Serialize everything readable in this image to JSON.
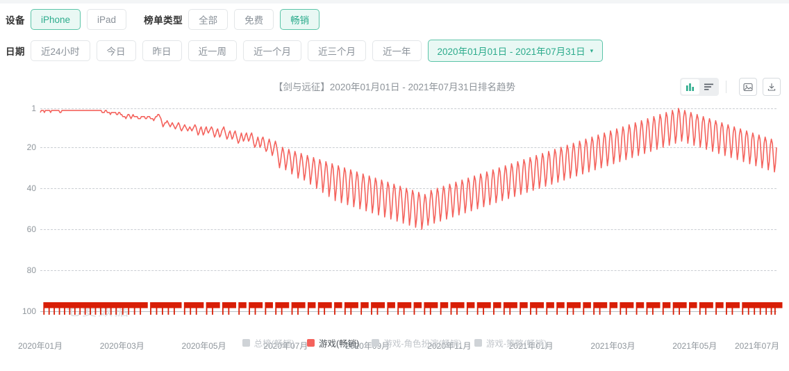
{
  "filters": {
    "device": {
      "label": "设备",
      "options": [
        {
          "label": "iPhone",
          "active": true
        },
        {
          "label": "iPad",
          "active": false
        }
      ]
    },
    "list_type": {
      "label": "榜单类型",
      "options": [
        {
          "label": "全部",
          "active": false
        },
        {
          "label": "免费",
          "active": false
        },
        {
          "label": "畅销",
          "active": true
        }
      ]
    },
    "date": {
      "label": "日期",
      "options": [
        {
          "label": "近24小时",
          "active": false
        },
        {
          "label": "今日",
          "active": false
        },
        {
          "label": "昨日",
          "active": false
        },
        {
          "label": "近一周",
          "active": false
        },
        {
          "label": "近一个月",
          "active": false
        },
        {
          "label": "近三个月",
          "active": false
        },
        {
          "label": "近一年",
          "active": false
        }
      ],
      "range_picker": {
        "label": "2020年01月01日 - 2021年07月31日",
        "caret": "▾",
        "active": true
      }
    }
  },
  "chart_card": {
    "title": "【剑与远征】2020年01月01日 - 2021年07月31日排名趋势",
    "toolbar": {
      "view_chart": "bar-chart-icon",
      "view_list": "list-icon",
      "save_image": "image-icon",
      "download": "download-icon"
    },
    "watermark": "七麦数据"
  },
  "chart_data": {
    "type": "line",
    "title": "【剑与远征】2020年01月01日 - 2021年07月31日排名趋势",
    "xlabel": "",
    "ylabel": "",
    "y_inverted": true,
    "ylim": [
      1,
      100
    ],
    "yticks": [
      1,
      20,
      40,
      60,
      80,
      100
    ],
    "grid": true,
    "grid_style": "dashed",
    "legend_position": "bottom",
    "x_range": [
      "2020年01月01日",
      "2021年07月31日"
    ],
    "xticks": [
      "2020年01月",
      "2020年03月",
      "2020年05月",
      "2020年07月",
      "2020年09月",
      "2020年11月",
      "2021年01月",
      "2021年03月",
      "2021年05月",
      "2021年07月"
    ],
    "series": [
      {
        "name": "总榜(畅销)",
        "color": "#cfd3d7",
        "visible": false,
        "values": []
      },
      {
        "name": "游戏(畅销)",
        "color": "#f4625c",
        "visible": true,
        "values": [
          3,
          2,
          2,
          2,
          3,
          2,
          2,
          2,
          2,
          2,
          3,
          2,
          2,
          2,
          2,
          2,
          2,
          2,
          2,
          3,
          3,
          2,
          2,
          2,
          2,
          2,
          2,
          2,
          2,
          2,
          2,
          2,
          2,
          2,
          2,
          2,
          2,
          2,
          2,
          2,
          2,
          2,
          2,
          2,
          2,
          2,
          2,
          2,
          2,
          2,
          2,
          2,
          2,
          2,
          2,
          2,
          2,
          2,
          2,
          2,
          3,
          3,
          3,
          2,
          2,
          3,
          3,
          3,
          4,
          3,
          3,
          3,
          3,
          3,
          4,
          4,
          3,
          3,
          4,
          4,
          5,
          5,
          5,
          6,
          5,
          4,
          4,
          5,
          6,
          5,
          4,
          5,
          5,
          5,
          5,
          6,
          6,
          6,
          5,
          5,
          5,
          5,
          6,
          6,
          5,
          5,
          5,
          6,
          6,
          6,
          7,
          6,
          5,
          5,
          4,
          4,
          5,
          6,
          8,
          10,
          9,
          8,
          8,
          7,
          8,
          9,
          10,
          9,
          8,
          9,
          10,
          11,
          10,
          9,
          8,
          9,
          11,
          12,
          11,
          10,
          9,
          10,
          11,
          12,
          11,
          10,
          11,
          12,
          11,
          10,
          9,
          10,
          12,
          14,
          13,
          11,
          10,
          12,
          14,
          13,
          11,
          10,
          12,
          13,
          12,
          11,
          10,
          11,
          13,
          15,
          14,
          12,
          11,
          13,
          15,
          14,
          12,
          11,
          10,
          12,
          14,
          16,
          15,
          13,
          12,
          14,
          16,
          15,
          13,
          12,
          14,
          16,
          18,
          17,
          15,
          13,
          15,
          17,
          16,
          14,
          13,
          15,
          17,
          16,
          14,
          13,
          15,
          18,
          20,
          19,
          17,
          15,
          17,
          20,
          19,
          16,
          15,
          17,
          20,
          22,
          21,
          18,
          16,
          18,
          21,
          24,
          22,
          19,
          17,
          19,
          22,
          26,
          30,
          27,
          23,
          20,
          22,
          26,
          31,
          28,
          24,
          21,
          23,
          27,
          33,
          30,
          25,
          22,
          24,
          29,
          35,
          32,
          27,
          23,
          25,
          30,
          36,
          33,
          28,
          24,
          26,
          31,
          38,
          34,
          29,
          25,
          27,
          33,
          40,
          36,
          30,
          26,
          28,
          34,
          42,
          38,
          32,
          27,
          29,
          35,
          44,
          40,
          33,
          28,
          30,
          37,
          46,
          41,
          34,
          29,
          31,
          38,
          47,
          43,
          35,
          30,
          32,
          39,
          48,
          44,
          36,
          31,
          33,
          40,
          49,
          45,
          37,
          32,
          34,
          41,
          50,
          46,
          38,
          33,
          35,
          42,
          51,
          47,
          39,
          34,
          36,
          43,
          52,
          48,
          40,
          35,
          37,
          44,
          53,
          49,
          41,
          36,
          38,
          45,
          54,
          50,
          42,
          37,
          39,
          46,
          55,
          51,
          43,
          38,
          40,
          47,
          56,
          52,
          44,
          39,
          41,
          48,
          57,
          53,
          45,
          40,
          42,
          49,
          58,
          54,
          46,
          41,
          43,
          50,
          59,
          55,
          47,
          42,
          44,
          51,
          60,
          56,
          48,
          43,
          45,
          52,
          58,
          54,
          46,
          41,
          43,
          50,
          57,
          53,
          45,
          40,
          42,
          49,
          56,
          52,
          44,
          39,
          41,
          48,
          55,
          51,
          43,
          38,
          40,
          47,
          54,
          50,
          42,
          37,
          39,
          46,
          53,
          49,
          41,
          36,
          38,
          45,
          52,
          48,
          40,
          35,
          37,
          44,
          51,
          47,
          39,
          34,
          36,
          43,
          50,
          46,
          38,
          33,
          35,
          42,
          49,
          45,
          37,
          32,
          34,
          41,
          48,
          44,
          36,
          31,
          33,
          40,
          47,
          43,
          35,
          30,
          32,
          39,
          46,
          42,
          34,
          29,
          31,
          38,
          45,
          41,
          33,
          28,
          30,
          37,
          44,
          40,
          32,
          27,
          29,
          36,
          43,
          39,
          31,
          26,
          28,
          35,
          42,
          38,
          30,
          25,
          27,
          34,
          41,
          37,
          29,
          24,
          26,
          33,
          40,
          36,
          28,
          23,
          25,
          32,
          39,
          35,
          27,
          22,
          24,
          31,
          38,
          34,
          26,
          21,
          23,
          30,
          37,
          33,
          25,
          20,
          22,
          29,
          36,
          32,
          24,
          19,
          21,
          28,
          35,
          31,
          23,
          18,
          20,
          27,
          34,
          30,
          22,
          17,
          19,
          26,
          33,
          29,
          21,
          16,
          18,
          25,
          32,
          28,
          20,
          15,
          17,
          24,
          31,
          27,
          19,
          14,
          16,
          23,
          30,
          26,
          18,
          13,
          15,
          22,
          29,
          25,
          17,
          12,
          14,
          21,
          28,
          24,
          16,
          11,
          13,
          20,
          27,
          23,
          15,
          10,
          12,
          19,
          26,
          22,
          14,
          9,
          11,
          18,
          25,
          21,
          13,
          8,
          10,
          17,
          24,
          20,
          12,
          7,
          9,
          16,
          23,
          19,
          11,
          6,
          8,
          15,
          22,
          18,
          10,
          5,
          7,
          14,
          21,
          17,
          9,
          4,
          6,
          13,
          20,
          16,
          8,
          3,
          5,
          12,
          19,
          15,
          7,
          2,
          4,
          11,
          18,
          14,
          6,
          1,
          3,
          10,
          17,
          13,
          5,
          2,
          4,
          11,
          18,
          14,
          6,
          3,
          5,
          12,
          19,
          15,
          7,
          4,
          6,
          13,
          20,
          16,
          8,
          5,
          7,
          14,
          21,
          17,
          9,
          6,
          8,
          15,
          22,
          18,
          10,
          7,
          9,
          16,
          23,
          19,
          11,
          8,
          10,
          17,
          24,
          20,
          12,
          9,
          11,
          18,
          25,
          21,
          13,
          10,
          12,
          19,
          26,
          22,
          14,
          11,
          13,
          20,
          27,
          23,
          15,
          12,
          14,
          21,
          28,
          24,
          16,
          13,
          15,
          22,
          29,
          25,
          17,
          14,
          16,
          23,
          30,
          26,
          18,
          15,
          17,
          24,
          31,
          27,
          19,
          16,
          18,
          25,
          32,
          28,
          20
        ]
      },
      {
        "name": "游戏-角色扮演(畅销)",
        "color": "#cfd3d7",
        "visible": false,
        "values": []
      },
      {
        "name": "游戏-策略(畅销)",
        "color": "#cfd3d7",
        "visible": false,
        "values": []
      }
    ],
    "markers": {
      "name": "事件标记",
      "symbol": "red-flag",
      "color": "#d81e06",
      "baseline_rank": 100,
      "positions": [
        0.005,
        0.012,
        0.019,
        0.026,
        0.033,
        0.04,
        0.047,
        0.054,
        0.061,
        0.068,
        0.075,
        0.082,
        0.089,
        0.096,
        0.103,
        0.112,
        0.12,
        0.128,
        0.136,
        0.15,
        0.158,
        0.166,
        0.174,
        0.182,
        0.196,
        0.204,
        0.212,
        0.226,
        0.234,
        0.248,
        0.256,
        0.27,
        0.284,
        0.292,
        0.306,
        0.32,
        0.328,
        0.342,
        0.35,
        0.364,
        0.378,
        0.386,
        0.4,
        0.414,
        0.422,
        0.436,
        0.45,
        0.458,
        0.472,
        0.486,
        0.494,
        0.508,
        0.522,
        0.53,
        0.544,
        0.558,
        0.566,
        0.58,
        0.594,
        0.602,
        0.616,
        0.63,
        0.638,
        0.652,
        0.666,
        0.674,
        0.688,
        0.702,
        0.716,
        0.724,
        0.738,
        0.752,
        0.76,
        0.774,
        0.788,
        0.796,
        0.81,
        0.824,
        0.832,
        0.846,
        0.86,
        0.868,
        0.882,
        0.896,
        0.904,
        0.918,
        0.932,
        0.94,
        0.954,
        0.962,
        0.97,
        0.978,
        0.986,
        0.993,
        0.998
      ]
    }
  },
  "legend": {
    "items": [
      {
        "label": "总榜(畅销)",
        "active": false
      },
      {
        "label": "游戏(畅销)",
        "active": true
      },
      {
        "label": "游戏-角色扮演(畅销)",
        "active": false
      },
      {
        "label": "游戏-策略(畅销)",
        "active": false
      }
    ]
  }
}
